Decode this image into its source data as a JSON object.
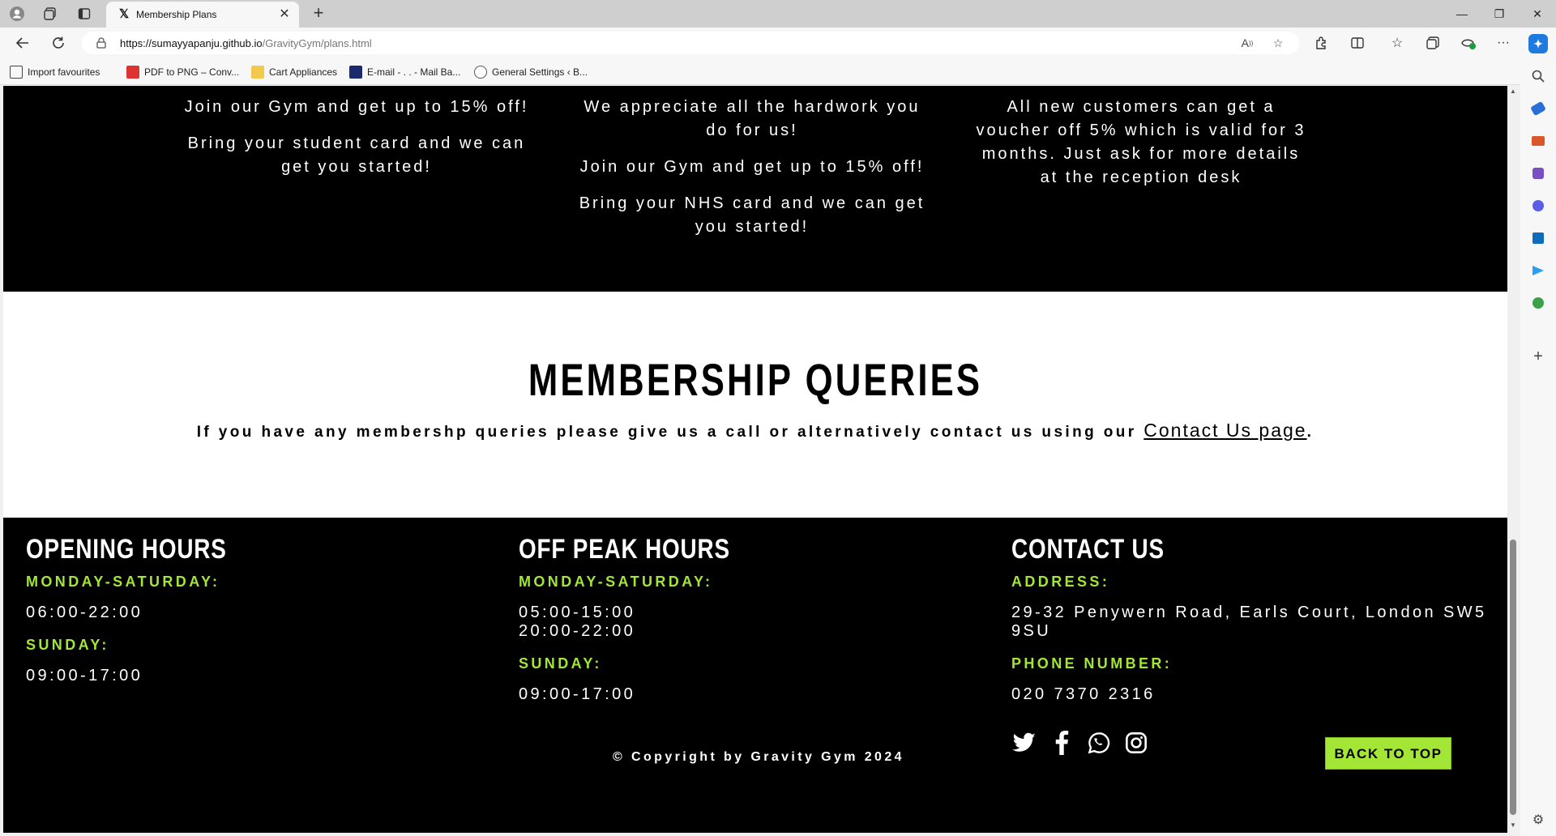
{
  "browser": {
    "tab_title": "Membership Plans",
    "url_host": "https://sumayyapanju.github.io",
    "url_path": "/GravityGym/plans.html",
    "bookmarks": [
      {
        "label": "Import favourites",
        "icon": "import-icon"
      },
      {
        "label": "PDF to PNG – Conv...",
        "icon": "pdf-icon"
      },
      {
        "label": "Cart Appliances",
        "icon": "folder-icon"
      },
      {
        "label": "E-mail - . . - Mail Ba...",
        "icon": "mail-icon"
      },
      {
        "label": "General Settings ‹ B...",
        "icon": "wordpress-icon"
      }
    ]
  },
  "offers": {
    "students": [
      "Join our Gym and get up to 15% off!",
      "Bring your student card and we can get you started!"
    ],
    "nhs": [
      "We appreciate all the hardwork you do for us!",
      "Join our Gym and get up to 15% off!",
      "Bring your NHS card and we can get you started!"
    ],
    "new_customers": [
      "All new customers can get a voucher off 5% which is valid for 3 months. Just ask for more details at the reception desk"
    ]
  },
  "queries": {
    "title": "MEMBERSHIP QUERIES",
    "text": "If you have any membershp queries please give us a call or alternatively contact us using our ",
    "link": "Contact Us page",
    "end": "."
  },
  "footer": {
    "opening": {
      "title": "OPENING HOURS",
      "label1": "MONDAY-SATURDAY:",
      "val1": "06:00-22:00",
      "label2": "SUNDAY:",
      "val2": "09:00-17:00"
    },
    "offpeak": {
      "title": "OFF PEAK HOURS",
      "label1": "MONDAY-SATURDAY:",
      "val1a": "05:00-15:00",
      "val1b": "20:00-22:00",
      "label2": "SUNDAY:",
      "val2": "09:00-17:00"
    },
    "contact": {
      "title": "CONTACT US",
      "label1": "ADDRESS:",
      "val1": "29-32 Penywern Road, Earls Court, London SW5 9SU",
      "label2": "PHONE NUMBER:",
      "val2": "020 7370 2316"
    },
    "social": [
      "twitter-icon",
      "facebook-icon",
      "whatsapp-icon",
      "instagram-icon"
    ],
    "copyright": "© Copyright by Gravity Gym 2024",
    "back_to_top": "BACK TO TOP"
  },
  "colors": {
    "accent": "#a3e635",
    "bg_dark": "#000000"
  }
}
